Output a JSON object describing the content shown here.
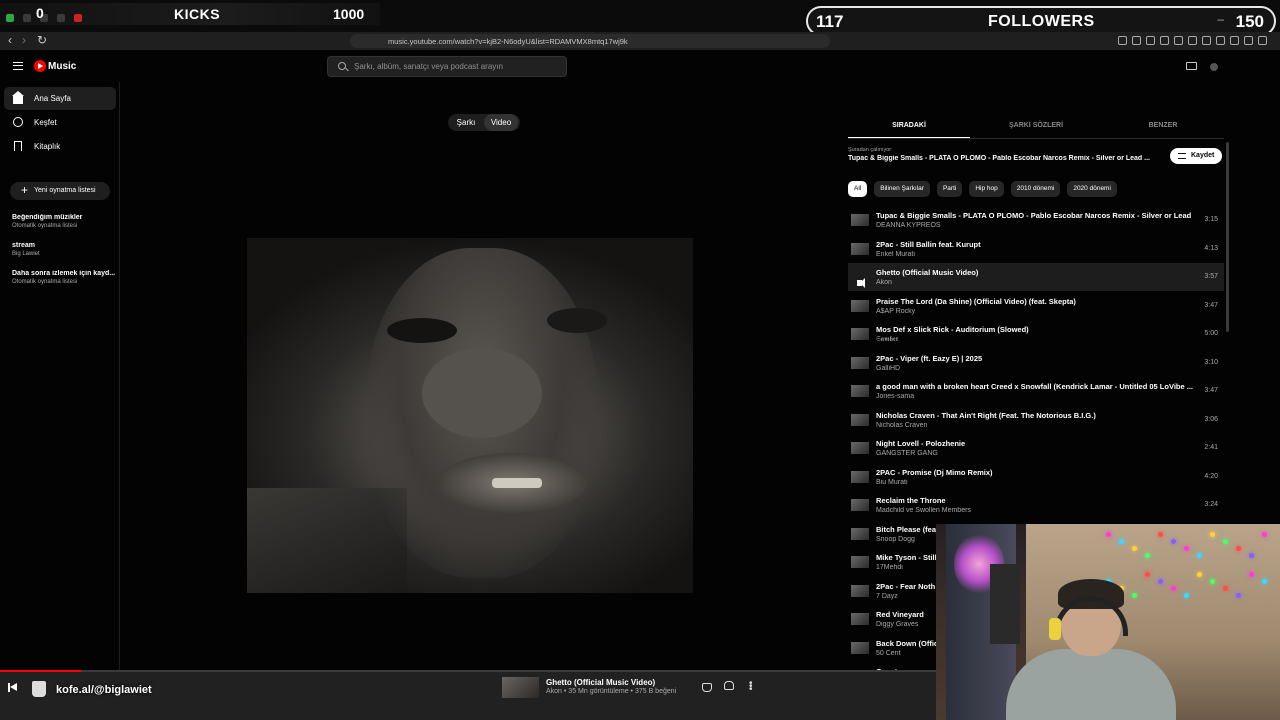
{
  "overlay": {
    "kicks_current": "0",
    "kicks_label": "KICKS",
    "kicks_goal": "1000",
    "followers_current": "117",
    "followers_label": "FOLLOWERS",
    "followers_goal": "150",
    "followers_minimize": "–"
  },
  "browser": {
    "url": "music.youtube.com/watch?v=kjB2-N6odyU&list=RDAMVMX8mtq17wj9k"
  },
  "header": {
    "logo_text": "Music",
    "search_placeholder": "Şarkı, albüm, sanatçı veya podcast arayın"
  },
  "sidebar": {
    "items": [
      {
        "label": "Ana Sayfa",
        "icon": "home-icon"
      },
      {
        "label": "Keşfet",
        "icon": "compass-icon"
      },
      {
        "label": "Kitaplık",
        "icon": "library-icon"
      }
    ],
    "new_playlist": "Yeni oynatma listesi",
    "playlists": [
      {
        "title": "Beğendiğim müzikler",
        "subtitle": "Otomatik oynatma listesi"
      },
      {
        "title": "stream",
        "subtitle": "Big Lawiet"
      },
      {
        "title": "Daha sonra izlemek için kayd...",
        "subtitle": "Otomatik oynatma listesi"
      }
    ]
  },
  "player": {
    "toggle_song": "Şarkı",
    "toggle_video": "Video"
  },
  "panel": {
    "tabs": [
      "SIRADAKİ",
      "ŞARKI SÖZLERİ",
      "BENZER"
    ],
    "from_label": "Şuradan çalınıyor:",
    "from_title": "Tupac & Biggie Smalls - PLATA O PLOMO - Pablo Escobar Narcos Remix - Silver or Lead ...",
    "save_label": "Kaydet",
    "chips": [
      "All",
      "Bilinen Şarkılar",
      "Parti",
      "Hip hop",
      "2010 dönemi",
      "2020 dönemi"
    ],
    "queue": [
      {
        "title": "Tupac & Biggie Smalls - PLATA O PLOMO - Pablo Escobar Narcos Remix - Silver or Lead",
        "artist": "DEANNA KYPREOS",
        "duration": "3:15"
      },
      {
        "title": "2Pac - Still Ballin feat. Kurupt",
        "artist": "Enkel Murati",
        "duration": "4:13"
      },
      {
        "title": "Ghetto (Official Music Video)",
        "artist": "Akon",
        "duration": "3:57"
      },
      {
        "title": "Praise The Lord (Da Shine) (Official Video) (feat. Skepta)",
        "artist": "A$AP Rocky",
        "duration": "3:47"
      },
      {
        "title": "Mos Def x Slick Rick - Auditorium (Slowed)",
        "artist": "𝕾𝖆𝖒𝖇𝖊𝖗",
        "duration": "5:00"
      },
      {
        "title": "2Pac - Viper (ft. Eazy E) | 2025",
        "artist": "GalliHD",
        "duration": "3:10"
      },
      {
        "title": "a good man with a broken heart Creed x Snowfall (Kendrick Lamar - Untitled 05 LoVibe ...",
        "artist": "Jones-sama",
        "duration": "3:47"
      },
      {
        "title": "Nicholas Craven - That Ain't Right (Feat. The Notorious B.I.G.)",
        "artist": "Nicholas Craven",
        "duration": "3:06"
      },
      {
        "title": "Night Lovell - Polozhenie",
        "artist": "GANGSTER GANG",
        "duration": "2:41"
      },
      {
        "title": "2PAC - Promise (Dj Mimo Remix)",
        "artist": "Biu Murati",
        "duration": "4:20"
      },
      {
        "title": "Reclaim the Throne",
        "artist": "Madchild ve Swollen Members",
        "duration": "3:24"
      },
      {
        "title": "Bitch Please (feat. Xzibit)",
        "artist": "Snoop Dogg",
        "duration": ""
      },
      {
        "title": "Mike Tyson - Still",
        "artist": "17Mehdi",
        "duration": ""
      },
      {
        "title": "2Pac - Fear Noth",
        "artist": "7 Dayz",
        "duration": ""
      },
      {
        "title": "Red Vineyard",
        "artist": "Diggy Graves",
        "duration": ""
      },
      {
        "title": "Back Down (Offici",
        "artist": "50 Cent",
        "duration": ""
      },
      {
        "title": "Questgame",
        "artist": "",
        "duration": ""
      }
    ],
    "playing_index": 2
  },
  "now_playing": {
    "title": "Ghetto (Official Music Video)",
    "meta": "Akon • 35 Mn görüntüleme • 375 B beğeni",
    "progress": 0.063
  },
  "stream": {
    "kofe_text": "kofe.al/@biglawiet"
  },
  "colors": {
    "accent": "#ff0000",
    "background": "#030303",
    "panel": "#212121"
  }
}
